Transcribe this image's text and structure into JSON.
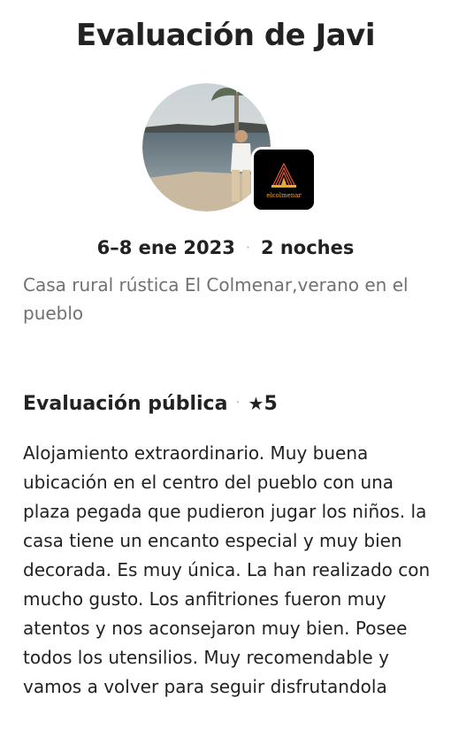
{
  "header": {
    "title": "Evaluación de Javi"
  },
  "stay": {
    "dates": "6–8 ene 2023",
    "nights": "2 noches",
    "separator": "·",
    "listing_name": "Casa rural rústica El Colmenar,verano en el pueblo"
  },
  "listing_thumb": {
    "logo_text": "elcolmenar"
  },
  "public_review": {
    "heading": "Evaluación pública",
    "separator": "·",
    "star_icon": "★",
    "rating": "5",
    "text": "Alojamiento extraordinario. Muy buena ubicación en el centro del pueblo con una plaza pegada que pudieron jugar los niños. la casa tiene un encanto especial y muy bien decorada. Es muy única. La han realizado con mucho gusto. Los anfitriones fueron muy atentos y nos aconsejaron muy bien. Posee todos los utensilios. Muy recomendable y vamos a volver para seguir disfrutandola"
  },
  "colors": {
    "text_primary": "#222222",
    "text_secondary": "#717171",
    "separator": "#b0b0b0"
  }
}
